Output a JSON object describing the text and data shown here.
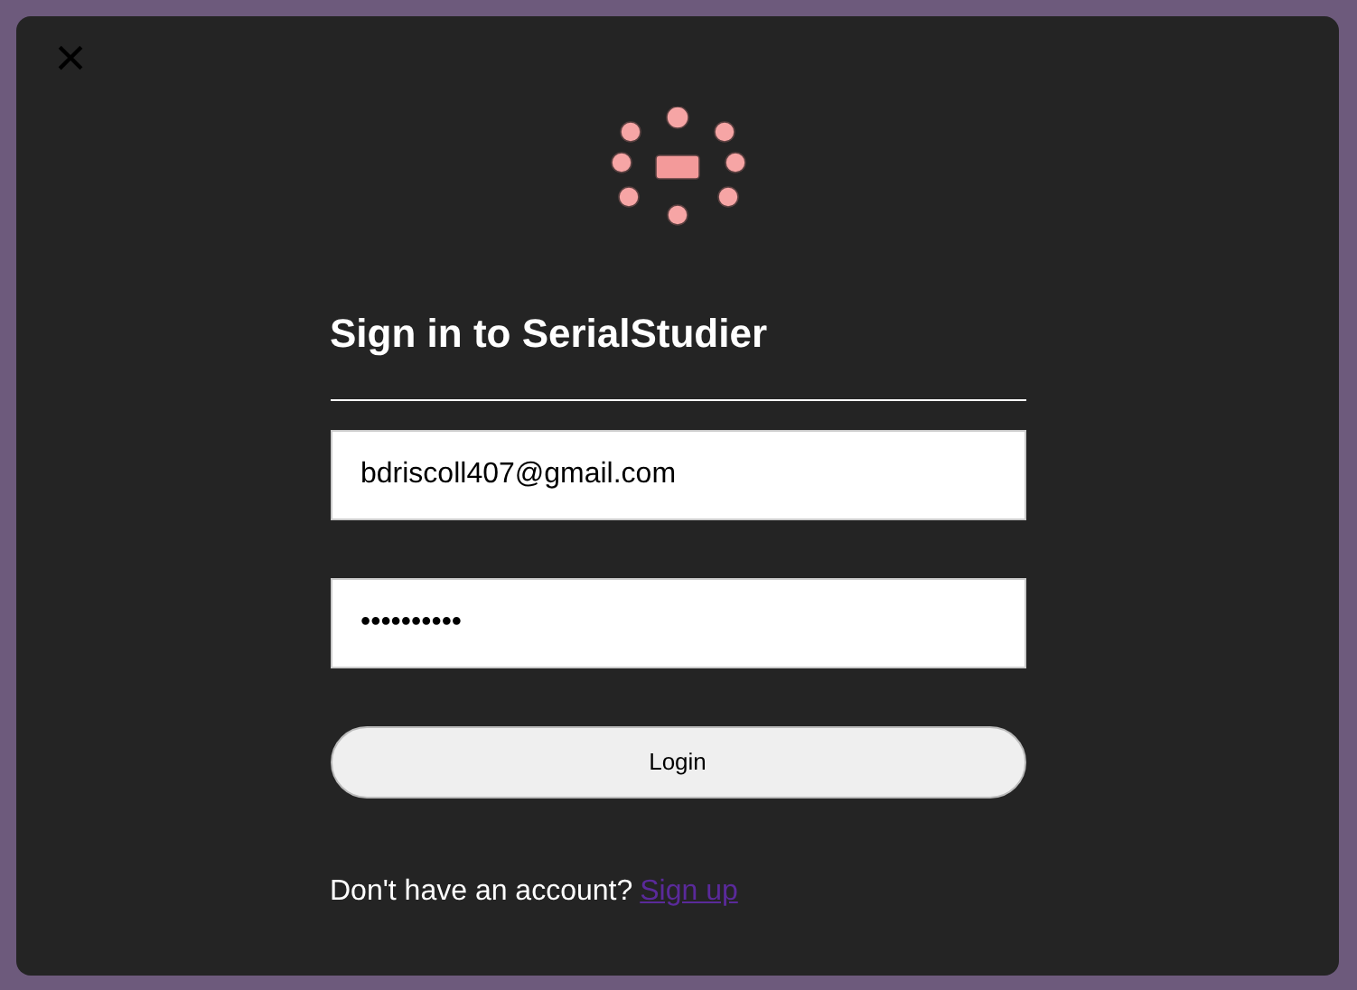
{
  "dialog": {
    "close": "×"
  },
  "title": "Sign in to SerialStudier",
  "email": {
    "value": "bdriscoll407@gmail.com"
  },
  "password": {
    "value": "••••••••••"
  },
  "login_button": "Login",
  "footer": {
    "prompt": "Don't have an account?",
    "link": "Sign up"
  }
}
